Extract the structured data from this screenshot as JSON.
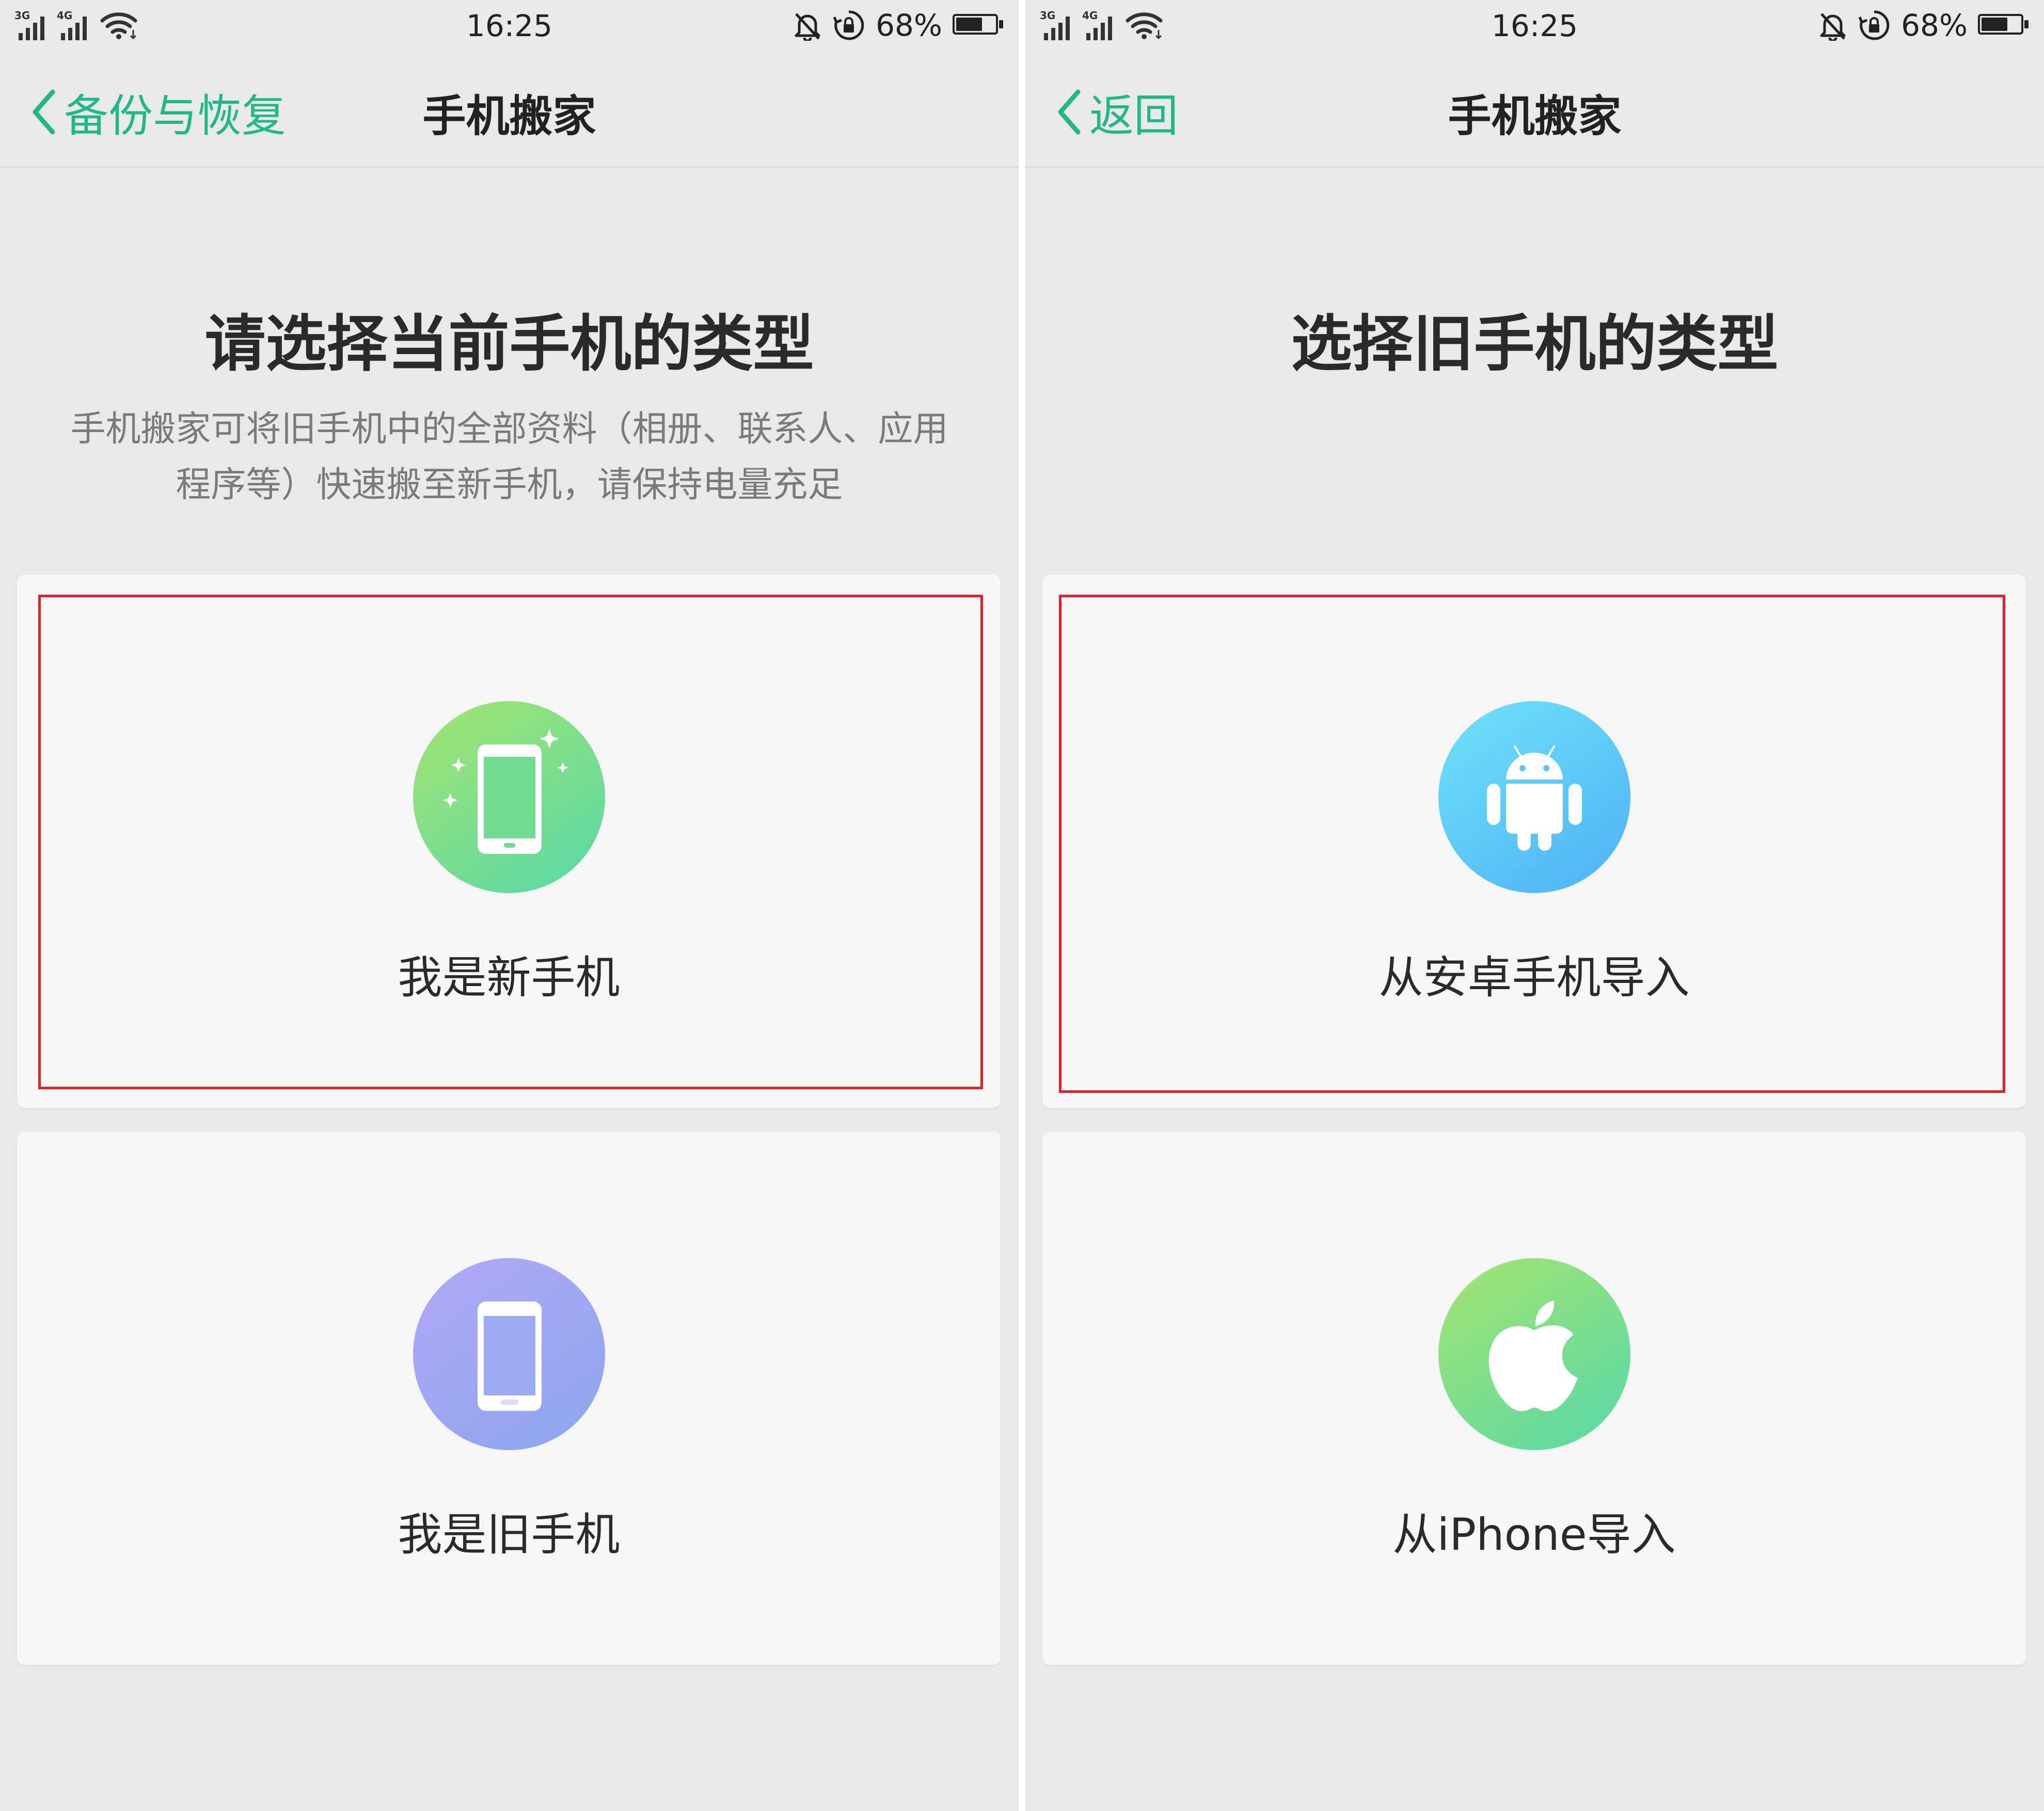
{
  "screens": [
    {
      "status": {
        "left_net": "3G",
        "right_net": "4G",
        "time": "16:25",
        "battery": "68%",
        "battery_level": 0.68
      },
      "nav": {
        "back_label": "备份与恢复",
        "title": "手机搬家"
      },
      "heading": "请选择当前手机的类型",
      "description": "手机搬家可将旧手机中的全部资料（相册、联系人、应用程序等）快速搬至新手机，请保持电量充足",
      "options": [
        {
          "label": "我是新手机",
          "icon": "sparkle-phone-icon"
        },
        {
          "label": "我是旧手机",
          "icon": "phone-icon"
        }
      ]
    },
    {
      "status": {
        "left_net": "3G",
        "right_net": "4G",
        "time": "16:25",
        "battery": "68%",
        "battery_level": 0.68
      },
      "nav": {
        "back_label": "返回",
        "title": "手机搬家"
      },
      "heading": "选择旧手机的类型",
      "options": [
        {
          "label": "从安卓手机导入",
          "icon": "android-icon"
        },
        {
          "label": "从iPhone导入",
          "icon": "apple-icon"
        }
      ]
    }
  ],
  "colors": {
    "accent": "#21b889",
    "highlight": "#e0212c",
    "background": "#e9e9e9",
    "card": "#f6f6f6"
  }
}
